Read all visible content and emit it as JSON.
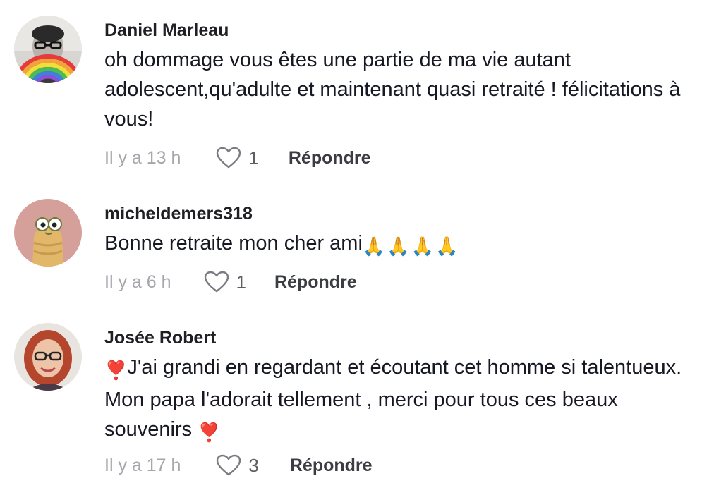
{
  "comments": [
    {
      "username": "Daniel Marleau",
      "text": "oh dommage vous êtes une partie de ma vie autant adolescent,qu'adulte et maintenant quasi retraité ! félicitations à vous!",
      "time": "Il y a 13 h",
      "likes": "1",
      "reply_label": "Répondre",
      "avatar_icon": "portrait-rainbow-avatar"
    },
    {
      "username": "micheldemers318",
      "text": "Bonne retraite mon cher ami",
      "emoji": "🙏🙏🙏🙏",
      "time": "Il y a 6 h",
      "likes": "1",
      "reply_label": "Répondre",
      "avatar_icon": "cartoon-character-avatar"
    },
    {
      "username": "Josée Robert",
      "emoji_lead": "❣️",
      "text": "J'ai grandi en regardant et écoutant cet homme si talentueux. Mon papa l'adorait tellement , merci pour tous ces beaux souvenirs",
      "emoji_trail": "❣️",
      "time": "Il y a 17 h",
      "likes": "3",
      "reply_label": "Répondre",
      "avatar_icon": "woman-glasses-avatar"
    }
  ],
  "colors": {
    "text": "#161823",
    "muted": "#a4a6ac",
    "reply": "#3b3d42"
  }
}
